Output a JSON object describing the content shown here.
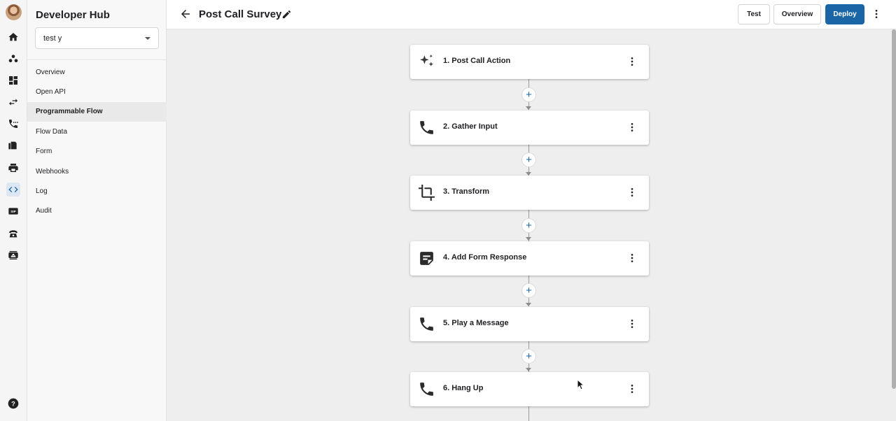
{
  "sidebar": {
    "app_title": "Developer Hub",
    "project_select": {
      "value": "test y"
    },
    "items": [
      {
        "label": "Overview"
      },
      {
        "label": "Open API"
      },
      {
        "label": "Programmable Flow",
        "active": true
      },
      {
        "label": "Flow Data"
      },
      {
        "label": "Form"
      },
      {
        "label": "Webhooks"
      },
      {
        "label": "Log"
      },
      {
        "label": "Audit"
      }
    ]
  },
  "rail": {
    "icons": [
      "avatar",
      "home-icon",
      "users-icon",
      "dashboard-icon",
      "swap-icon",
      "phone-dots-icon",
      "fax-icon",
      "print-icon",
      "code-icon",
      "sip-icon",
      "desk-phone-icon",
      "contact-card-icon",
      "help-icon"
    ],
    "active": "code-icon",
    "accent": "#1a65a6"
  },
  "header": {
    "title": "Post Call Survey",
    "buttons": {
      "test": "Test",
      "overview": "Overview",
      "deploy": "Deploy"
    },
    "deploy_color": "#1a65a6"
  },
  "flow": {
    "steps": [
      {
        "label": "1. Post Call Action",
        "icon": "sparkle-icon"
      },
      {
        "label": "2. Gather Input",
        "icon": "phone-icon"
      },
      {
        "label": "3. Transform",
        "icon": "crop-icon"
      },
      {
        "label": "4. Add Form Response",
        "icon": "form-response-icon"
      },
      {
        "label": "5. Play a Message",
        "icon": "phone-icon"
      },
      {
        "label": "6. Hang Up",
        "icon": "phone-icon"
      }
    ],
    "add_symbol": "+"
  }
}
